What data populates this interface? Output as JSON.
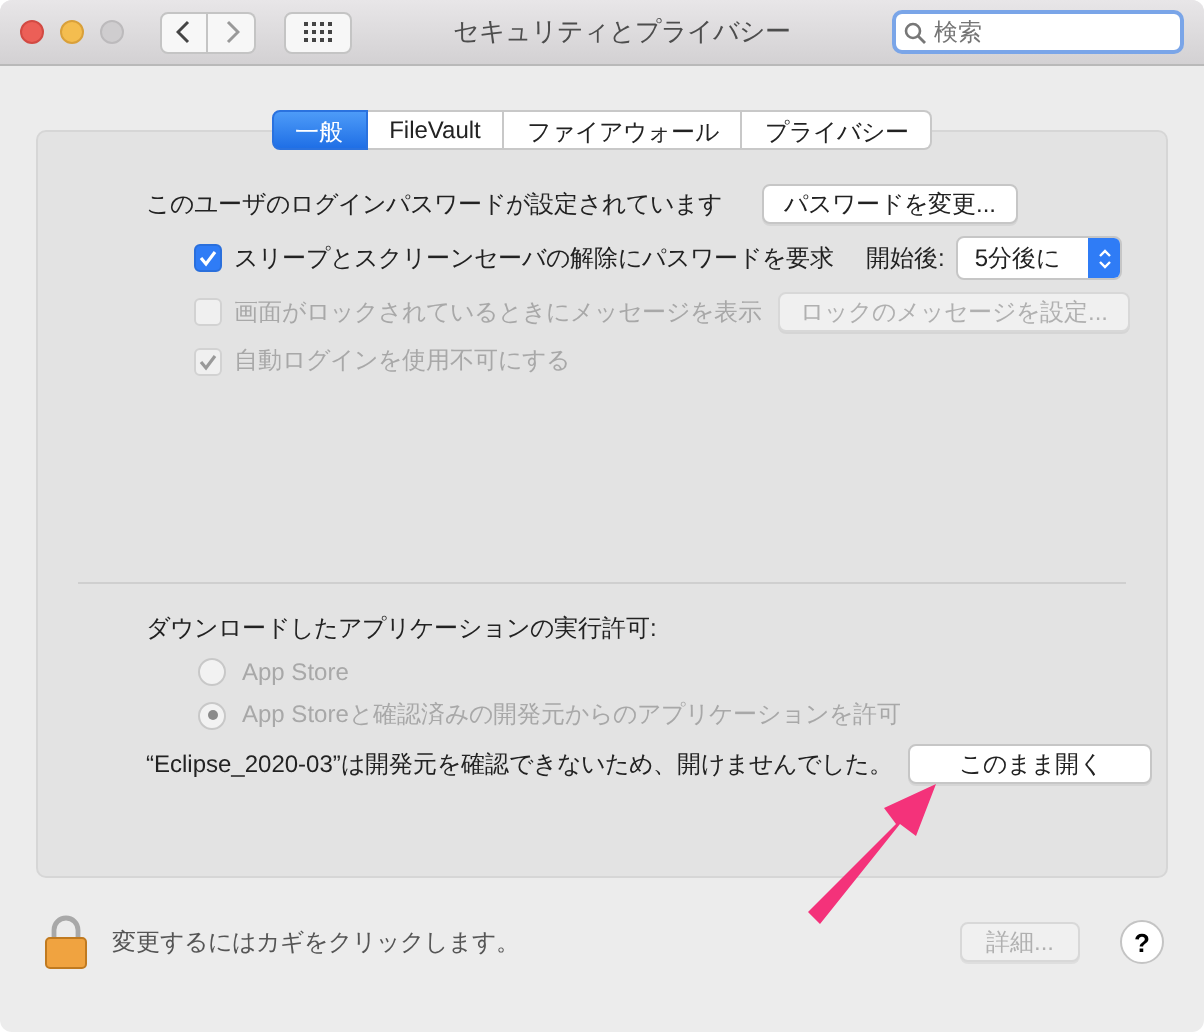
{
  "window": {
    "title": "セキュリティとプライバシー",
    "search": {
      "placeholder": "検索"
    }
  },
  "tabs": [
    {
      "label": "一般",
      "selected": true
    },
    {
      "label": "FileVault",
      "selected": false
    },
    {
      "label": "ファイアウォール",
      "selected": false
    },
    {
      "label": "プライバシー",
      "selected": false
    }
  ],
  "password": {
    "text": "このユーザのログインパスワードが設定されています",
    "button": {
      "label": "パスワードを変更...",
      "disabled": false
    }
  },
  "options": [
    {
      "label": "スリープとスクリーンセーバの解除にパスワードを要求",
      "checked": true,
      "disabled": false,
      "delay": {
        "label": "開始後:",
        "value": "5分後に"
      }
    },
    {
      "label": "画面がロックされているときにメッセージを表示",
      "checked": false,
      "disabled": true,
      "button": {
        "label": "ロックのメッセージを設定...",
        "disabled": true
      }
    },
    {
      "label": "自動ログインを使用不可にする",
      "checked": true,
      "disabled": true
    }
  ],
  "downloads": {
    "heading": "ダウンロードしたアプリケーションの実行許可:",
    "choices": [
      {
        "label": "App Store",
        "selected": false,
        "disabled": true
      },
      {
        "label": "App Storeと確認済みの開発元からのアプリケーションを許可",
        "selected": true,
        "disabled": true
      }
    ]
  },
  "blocked": {
    "message": "“Eclipse_2020-03”は開発元を確認できないため、開けませんでした。",
    "button": {
      "label": "このまま開く",
      "disabled": false
    }
  },
  "footer": {
    "lock_text": "変更するにはカギをクリックします。",
    "advanced": {
      "label": "詳細...",
      "disabled": true
    },
    "help": "?"
  }
}
